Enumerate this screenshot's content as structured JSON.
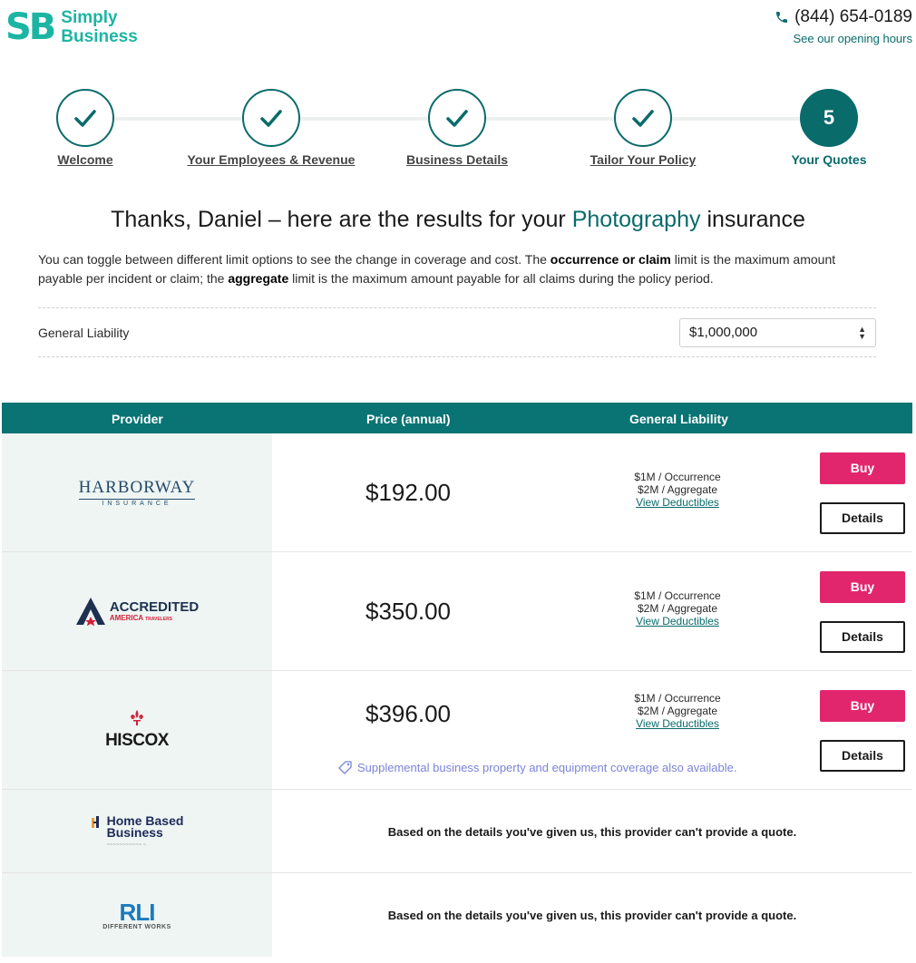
{
  "header": {
    "logo_mark": "SB",
    "logo_line1": "Simply",
    "logo_line2": "Business",
    "phone": "(844) 654-0189",
    "hours_link": "See our opening hours"
  },
  "progress": {
    "steps": [
      {
        "label": "Welcome",
        "state": "done"
      },
      {
        "label": "Your Employees & Revenue",
        "state": "done"
      },
      {
        "label": "Business Details",
        "state": "done"
      },
      {
        "label": "Tailor Your Policy",
        "state": "done"
      },
      {
        "label": "Your Quotes",
        "state": "active",
        "number": "5"
      }
    ]
  },
  "title": {
    "before": "Thanks, Daniel – here are the results for your ",
    "accent": "Photography",
    "after": " insurance"
  },
  "intro": {
    "part1": "You can toggle between different limit options to see the change in coverage and cost. The ",
    "bold1": "occurrence or claim",
    "part2": " limit is the maximum amount payable per incident or claim; the ",
    "bold2": "aggregate",
    "part3": " limit is the maximum amount payable for all claims during the policy period."
  },
  "limit": {
    "label": "General Liability",
    "selected": "$1,000,000"
  },
  "table": {
    "headers": {
      "provider": "Provider",
      "price": "Price (annual)",
      "coverage": "General Liability"
    },
    "buy_label": "Buy",
    "details_label": "Details",
    "coverage_occurrence": "$1M / Occurrence",
    "coverage_aggregate": "$2M / Aggregate",
    "deductibles_link": "View Deductibles",
    "no_quote": "Based on the details you've given us, this provider can't provide a quote.",
    "supplemental_note": "Supplemental business property and equipment coverage also available.",
    "rows": [
      {
        "provider": "Harborway Insurance",
        "logo_main": "HARBORWAY",
        "logo_sub": "INSURANCE",
        "price": "$192.00"
      },
      {
        "provider": "Accredited America",
        "logo_main": "ACCREDITED",
        "logo_sub": "AMERICA",
        "logo_tag": "TRAVELERS",
        "price": "$350.00"
      },
      {
        "provider": "Hiscox",
        "logo_main": "HISCOX",
        "price": "$396.00"
      },
      {
        "provider": "Home Based Business",
        "logo_main1": "Home Based",
        "logo_main2": "Business"
      },
      {
        "provider": "RLI",
        "logo_main": "RLI",
        "logo_sub": "DIFFERENT WORKS"
      }
    ]
  },
  "colors": {
    "brand_teal": "#1cb5a3",
    "dark_teal": "#0a6b6b",
    "buy_pink": "#e2266d",
    "supplemental_blue": "#7a84d8"
  }
}
